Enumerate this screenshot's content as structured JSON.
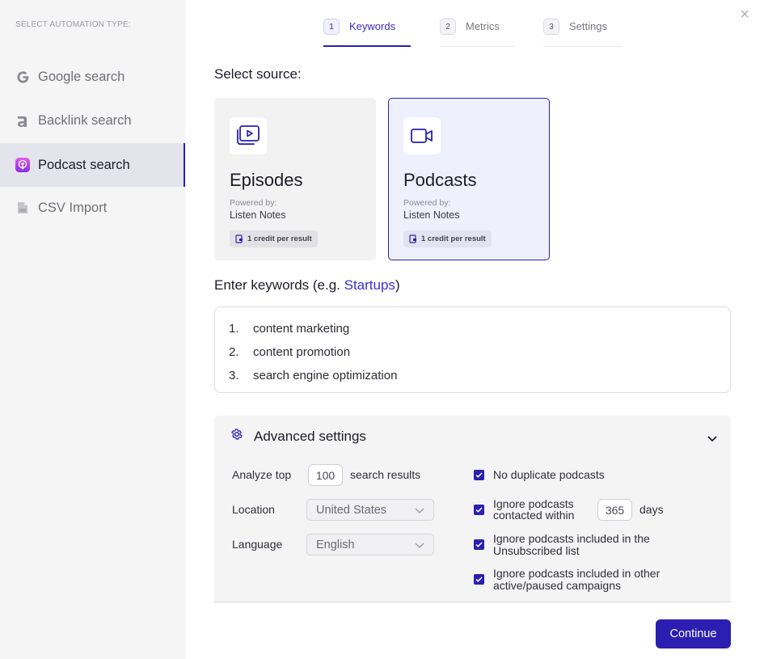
{
  "sidebar": {
    "heading": "SELECT AUTOMATION TYPE:",
    "items": [
      {
        "label": "Google search",
        "icon": "google-icon"
      },
      {
        "label": "Backlink search",
        "icon": "ahrefs-icon"
      },
      {
        "label": "Podcast search",
        "icon": "podcast-icon",
        "active": true
      },
      {
        "label": "CSV Import",
        "icon": "csv-file-icon"
      }
    ]
  },
  "steps": [
    {
      "num": "1",
      "label": "Keywords",
      "active": true
    },
    {
      "num": "2",
      "label": "Metrics"
    },
    {
      "num": "3",
      "label": "Settings"
    }
  ],
  "source": {
    "title": "Select source:",
    "cards": [
      {
        "title": "Episodes",
        "powered_label": "Powered by:",
        "provider": "Listen Notes",
        "credit": "1 credit per result",
        "icon": "video-playlist-icon"
      },
      {
        "title": "Podcasts",
        "powered_label": "Powered by:",
        "provider": "Listen Notes",
        "credit": "1 credit per result",
        "icon": "video-camera-icon",
        "selected": true
      }
    ]
  },
  "keywords": {
    "label_prefix": "Enter keywords (e.g. ",
    "example": "Startups",
    "label_suffix": ")",
    "items": [
      {
        "num": "1.",
        "text": "content marketing"
      },
      {
        "num": "2.",
        "text": "content promotion"
      },
      {
        "num": "3.",
        "text": "search engine optimization"
      }
    ]
  },
  "advanced": {
    "title": "Advanced settings",
    "analyze_label": "Analyze top",
    "analyze_value": "100",
    "analyze_suffix": "search results",
    "location_label": "Location",
    "location_value": "United States",
    "language_label": "Language",
    "language_value": "English",
    "options": {
      "no_duplicates": "No duplicate podcasts",
      "ignore_contacted_line1": "Ignore podcasts",
      "ignore_contacted_line2": "contacted within",
      "ignore_contacted_days": "365",
      "days_label": "days",
      "ignore_unsub_line1": "Ignore podcasts included in the",
      "ignore_unsub_line2": "Unsubscribed list",
      "ignore_campaigns_line1": "Ignore podcasts included in other",
      "ignore_campaigns_line2": "active/paused campaigns"
    }
  },
  "continue_label": "Continue",
  "close_glyph": "×",
  "colors": {
    "accent": "#2a1fb0",
    "link": "#3b2fd0",
    "selected_card_bg": "#eef0fe"
  }
}
